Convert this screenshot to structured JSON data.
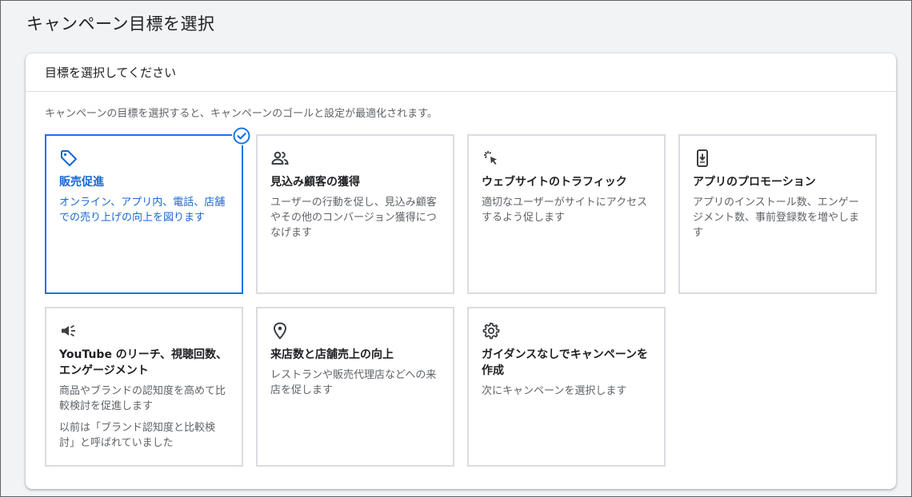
{
  "page": {
    "title": "キャンペーン目標を選択"
  },
  "panel": {
    "header": "目標を選択してください",
    "description": "キャンペーンの目標を選択すると、キャンペーンのゴールと設定が最適化されます。"
  },
  "accent_color": "#1a73e8",
  "cards": [
    {
      "icon": "tag-icon",
      "title": "販売促進",
      "desc": "オンライン、アプリ内、電話、店舗での売り上げの向上を図ります",
      "selected": true
    },
    {
      "icon": "people-icon",
      "title": "見込み顧客の獲得",
      "desc": "ユーザーの行動を促し、見込み顧客やその他のコンバージョン獲得につなげます",
      "selected": false
    },
    {
      "icon": "cursor-click-icon",
      "title": "ウェブサイトのトラフィック",
      "desc": "適切なユーザーがサイトにアクセスするよう促します",
      "selected": false
    },
    {
      "icon": "phone-download-icon",
      "title": "アプリのプロモーション",
      "desc": "アプリのインストール数、エンゲージメント数、事前登録数を増やします",
      "selected": false
    },
    {
      "icon": "megaphone-icon",
      "title": "YouTube のリーチ、視聴回数、エンゲージメント",
      "desc": "商品やブランドの認知度を高めて比較検討を促進します",
      "desc2": "以前は「ブランド認知度と比較検討」と呼ばれていました",
      "selected": false
    },
    {
      "icon": "location-pin-icon",
      "title": "来店数と店舗売上の向上",
      "desc": "レストランや販売代理店などへの来店を促します",
      "selected": false
    },
    {
      "icon": "gear-icon",
      "title": "ガイダンスなしでキャンペーンを作成",
      "desc": "次にキャンペーンを選択します",
      "selected": false
    }
  ]
}
